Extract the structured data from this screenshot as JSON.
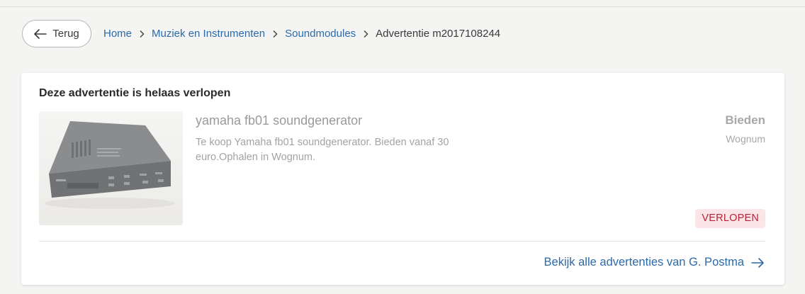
{
  "nav": {
    "back_label": "Terug",
    "breadcrumbs": [
      {
        "label": "Home"
      },
      {
        "label": "Muziek en Instrumenten"
      },
      {
        "label": "Soundmodules"
      },
      {
        "label": "Advertentie m2017108244"
      }
    ]
  },
  "card": {
    "heading": "Deze advertentie is helaas verlopen",
    "listing": {
      "title": "yamaha fb01 soundgenerator",
      "description": "Te koop Yamaha fb01 soundgenerator. Bieden vanaf 30 euro.Ophalen in Wognum.",
      "price": "Bieden",
      "location": "Wognum",
      "status": "VERLOPEN",
      "image_icon": "sound-module-photo"
    },
    "seller_link": "Bekijk alle advertenties van G. Postma"
  },
  "colors": {
    "link": "#2c6aa9",
    "badge_bg": "#fbe5e8",
    "badge_text": "#b3263a",
    "page_bg": "#f4f4f3"
  }
}
